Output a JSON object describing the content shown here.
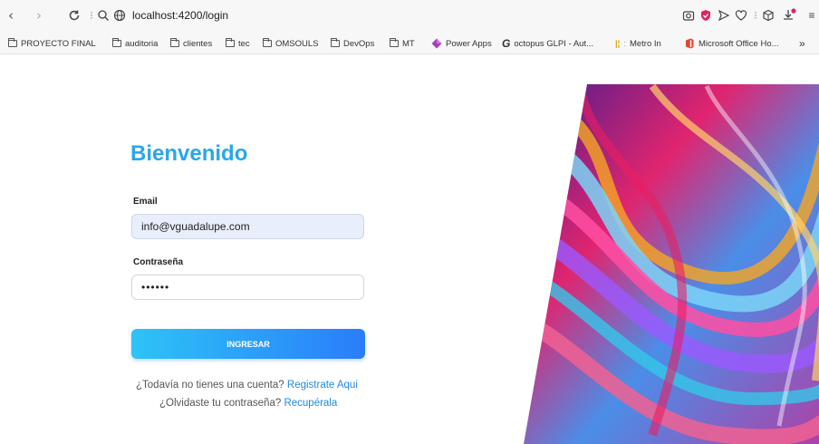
{
  "browser": {
    "url": "localhost:4200/login",
    "bookmarks": [
      {
        "label": "PROYECTO FINAL",
        "icon": "folder-icon"
      },
      {
        "label": "auditoria",
        "icon": "folder-icon"
      },
      {
        "label": "clientes",
        "icon": "folder-icon"
      },
      {
        "label": "tec",
        "icon": "folder-icon"
      },
      {
        "label": "OMSOULS",
        "icon": "folder-icon"
      },
      {
        "label": "DevOps",
        "icon": "folder-icon"
      },
      {
        "label": "MT",
        "icon": "folder-icon"
      },
      {
        "label": "Power Apps",
        "icon": "power-apps-icon"
      },
      {
        "label": "octopus GLPI - Aut...",
        "icon": "glpi-icon"
      },
      {
        "label": "Metro In",
        "icon": "metro-icon"
      },
      {
        "label": "Microsoft Office Ho...",
        "icon": "office-icon"
      }
    ],
    "more": "»"
  },
  "login": {
    "title": "Bienvenido",
    "email_label": "Email",
    "email_value": "info@vguadalupe.com",
    "password_label": "Contraseña",
    "password_value": "••••••",
    "submit_label": "INGRESAR",
    "register_prompt": "¿Todavía no tienes una cuenta?",
    "register_link": "Registrate Aqui",
    "forgot_prompt": "¿Olvidaste tu contraseña?",
    "forgot_link": "Recupérala"
  },
  "colors": {
    "accent": "#2aa7ea",
    "button_start": "#2ec3f6",
    "button_end": "#2a7dfa",
    "link": "#1e88e5"
  }
}
